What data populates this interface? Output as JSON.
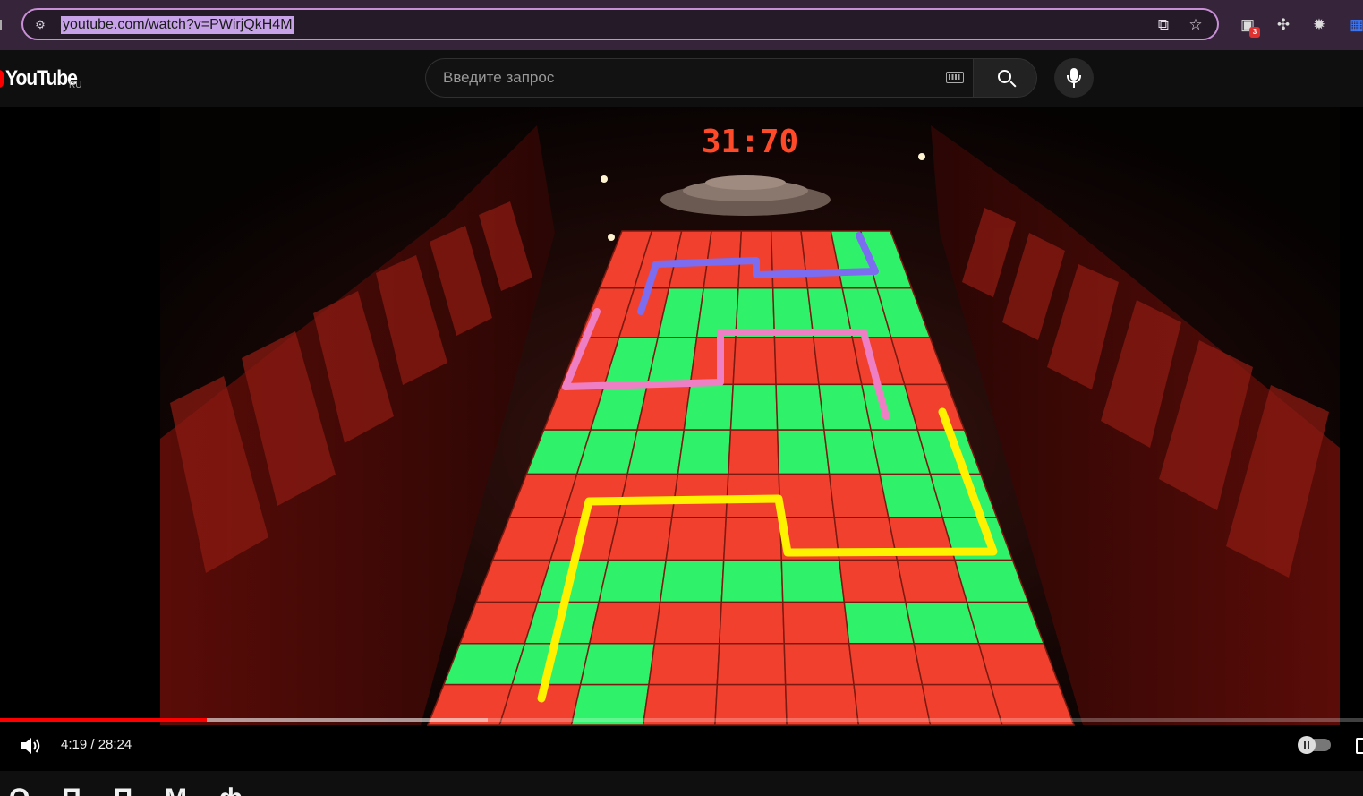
{
  "browser": {
    "url": "youtube.com/watch?v=PWirjQkH4M",
    "extension_badge": "3"
  },
  "masthead": {
    "logo_text": "YouTube",
    "country_code": "RU",
    "search_placeholder": "Введите запрос"
  },
  "video": {
    "scoreboard": "31:70",
    "current_time": "4:19",
    "duration": "28:24",
    "time_display": "4:19 / 28:24",
    "progress_fraction": 0.152,
    "buffered_fraction": 0.358,
    "autoplay": "paused",
    "path_colors": {
      "blue": "#7b6cf0",
      "pink": "#ef7fc4",
      "yellow": "#fff200"
    },
    "tile_colors": {
      "red": "#f2402e",
      "green": "#2ff26a"
    }
  },
  "below_player": {
    "title_partial": "О... П... П... М... ф..."
  }
}
